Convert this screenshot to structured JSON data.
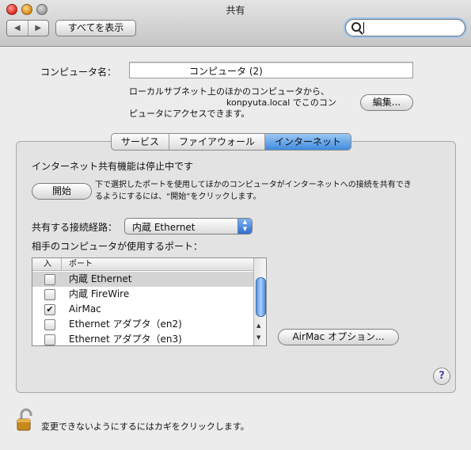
{
  "window": {
    "title": "共有"
  },
  "toolbar": {
    "back_glyph": "◀",
    "forward_glyph": "▶",
    "show_all_label": "すべてを表示",
    "search_placeholder": ""
  },
  "computer": {
    "name_label": "コンピュータ名：",
    "name_value": "コンピュータ (2)",
    "desc_line1": "ローカルサブネット上のほかのコンピュータから、",
    "desc_line2": "konpyuta.local でこのコン",
    "desc_line3": "ピュータにアクセスできます。",
    "edit_label": "編集..."
  },
  "tabs": [
    {
      "label": "サービス",
      "active": false
    },
    {
      "label": "ファイアウォール",
      "active": false
    },
    {
      "label": "インターネット",
      "active": true
    }
  ],
  "internet": {
    "status": "インターネット共有機能は停止中です",
    "start_label": "開始",
    "hint_line1": "下で選択したポートを使用してほかのコンピュータがインターネットへの接続を共有でき",
    "hint_line2": "るようにするには、“開始”をクリックします。",
    "share_from_label": "共有する接続経路：",
    "share_from_value": "内蔵 Ethernet",
    "ports_label": "相手のコンピュータが使用するポート：",
    "columns": [
      "入",
      "ポート"
    ],
    "ports": [
      {
        "name": "内蔵 Ethernet",
        "checked": false,
        "selected": true
      },
      {
        "name": "内蔵 FireWire",
        "checked": false,
        "selected": false
      },
      {
        "name": "AirMac",
        "checked": true,
        "selected": false
      },
      {
        "name": "Ethernet アダプタ（en2)",
        "checked": false,
        "selected": false
      },
      {
        "name": "Ethernet アダプタ（en3)",
        "checked": false,
        "selected": false
      }
    ],
    "airmac_options_label": "AirMac オプション...",
    "help_glyph": "?"
  },
  "footer": {
    "lock_text": "変更できないようにするにはカギをクリックします。"
  },
  "colors": {
    "accent": "#3f8be0",
    "lock_gold": "#c98a1c"
  }
}
